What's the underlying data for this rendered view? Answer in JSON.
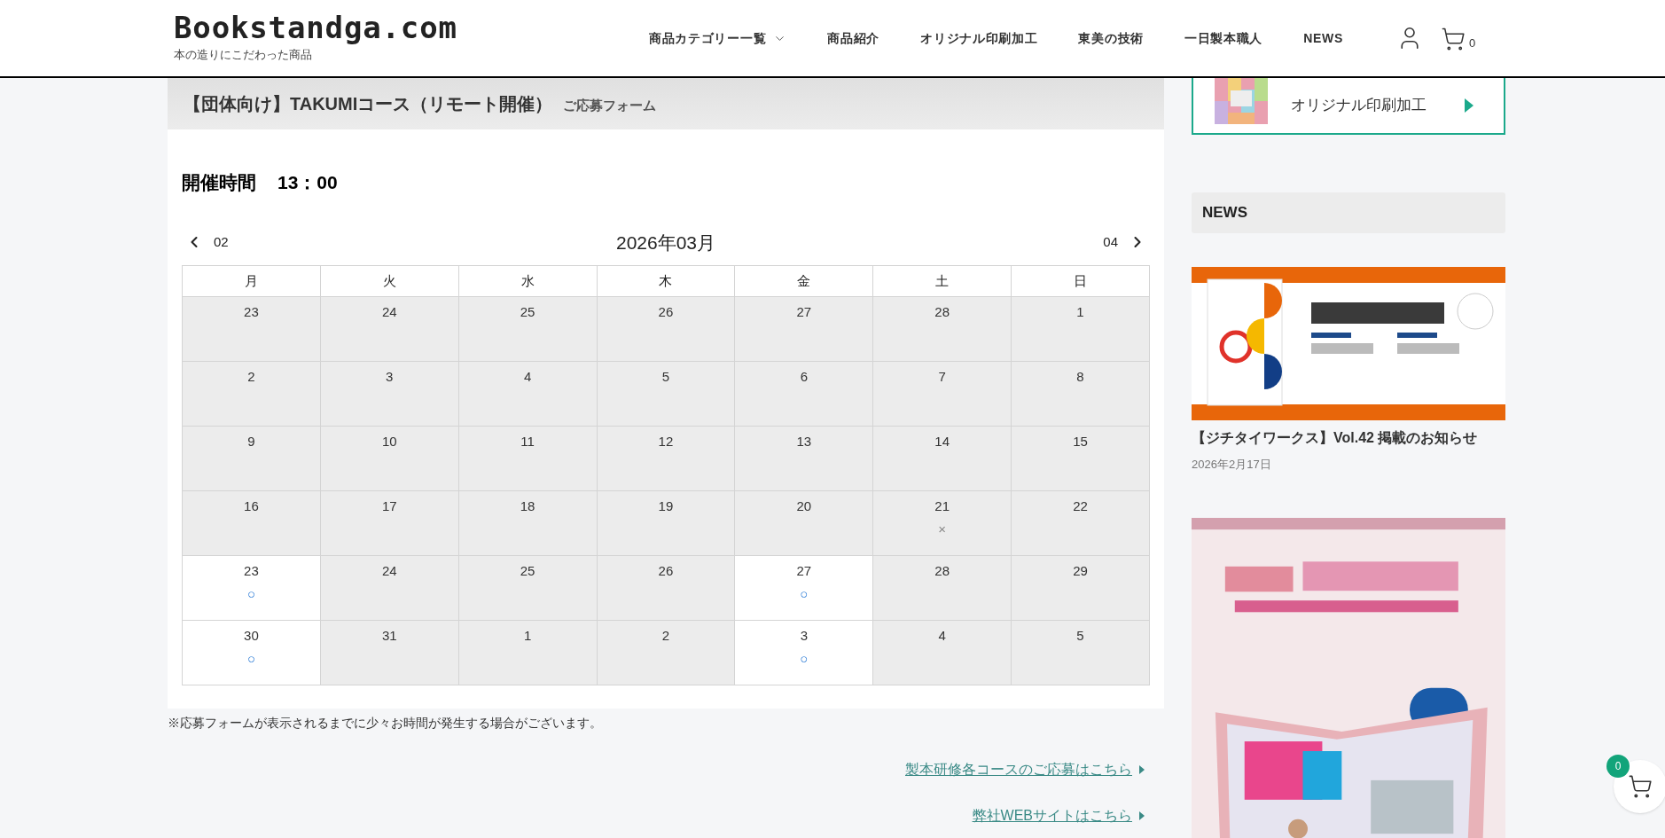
{
  "header": {
    "logo": "Bookstandga.com",
    "tagline": "本の造りにこだわった商品",
    "nav": [
      {
        "label": "商品カテゴリー一覧",
        "dropdown": true
      },
      {
        "label": "商品紹介",
        "dropdown": false
      },
      {
        "label": "オリジナル印刷加工",
        "dropdown": false
      },
      {
        "label": "東美の技術",
        "dropdown": false
      },
      {
        "label": "一日製本職人",
        "dropdown": false
      },
      {
        "label": "NEWS",
        "dropdown": false
      }
    ],
    "cart_count": "0"
  },
  "form": {
    "title": "【団体向け】TAKUMIコース（リモート開催）",
    "subtitle": "ご応募フォーム",
    "time_label": "開催時間",
    "time": "13：00"
  },
  "calendar": {
    "prev": "02",
    "month": "2026年03月",
    "next": "04",
    "weekdays": [
      "月",
      "火",
      "水",
      "木",
      "金",
      "土",
      "日"
    ],
    "weeks": [
      [
        {
          "day": "23",
          "available": false
        },
        {
          "day": "24",
          "available": false
        },
        {
          "day": "25",
          "available": false
        },
        {
          "day": "26",
          "available": false
        },
        {
          "day": "27",
          "available": false
        },
        {
          "day": "28",
          "available": false
        },
        {
          "day": "1",
          "available": false
        }
      ],
      [
        {
          "day": "2",
          "available": false
        },
        {
          "day": "3",
          "available": false
        },
        {
          "day": "4",
          "available": false
        },
        {
          "day": "5",
          "available": false
        },
        {
          "day": "6",
          "available": false
        },
        {
          "day": "7",
          "available": false
        },
        {
          "day": "8",
          "available": false
        }
      ],
      [
        {
          "day": "9",
          "available": false
        },
        {
          "day": "10",
          "available": false
        },
        {
          "day": "11",
          "available": false
        },
        {
          "day": "12",
          "available": false
        },
        {
          "day": "13",
          "available": false
        },
        {
          "day": "14",
          "available": false
        },
        {
          "day": "15",
          "available": false
        }
      ],
      [
        {
          "day": "16",
          "available": false
        },
        {
          "day": "17",
          "available": false
        },
        {
          "day": "18",
          "available": false
        },
        {
          "day": "19",
          "available": false
        },
        {
          "day": "20",
          "available": false
        },
        {
          "day": "21",
          "available": false,
          "mark": "×"
        },
        {
          "day": "22",
          "available": false
        }
      ],
      [
        {
          "day": "23",
          "available": true,
          "mark": "○"
        },
        {
          "day": "24",
          "available": false
        },
        {
          "day": "25",
          "available": false
        },
        {
          "day": "26",
          "available": false
        },
        {
          "day": "27",
          "available": true,
          "mark": "○"
        },
        {
          "day": "28",
          "available": false
        },
        {
          "day": "29",
          "available": false
        }
      ],
      [
        {
          "day": "30",
          "available": true,
          "mark": "○"
        },
        {
          "day": "31",
          "available": false
        },
        {
          "day": "1",
          "available": false
        },
        {
          "day": "2",
          "available": false
        },
        {
          "day": "3",
          "available": true,
          "mark": "○"
        },
        {
          "day": "4",
          "available": false
        },
        {
          "day": "5",
          "available": false
        }
      ]
    ]
  },
  "note": "※応募フォームが表示されるまでに少々お時間が発生する場合がございます。",
  "links": [
    "製本研修各コースのご応募はこちら",
    "弊社WEBサイトはこちら"
  ],
  "sidebar": {
    "banner_label": "オリジナル印刷加工",
    "news_heading": "NEWS",
    "news": [
      {
        "title": "【ジチタイワークス】Vol.42 掲載のお知らせ",
        "date": "2026年2月17日"
      }
    ]
  },
  "floating_cart": {
    "count": "0"
  }
}
